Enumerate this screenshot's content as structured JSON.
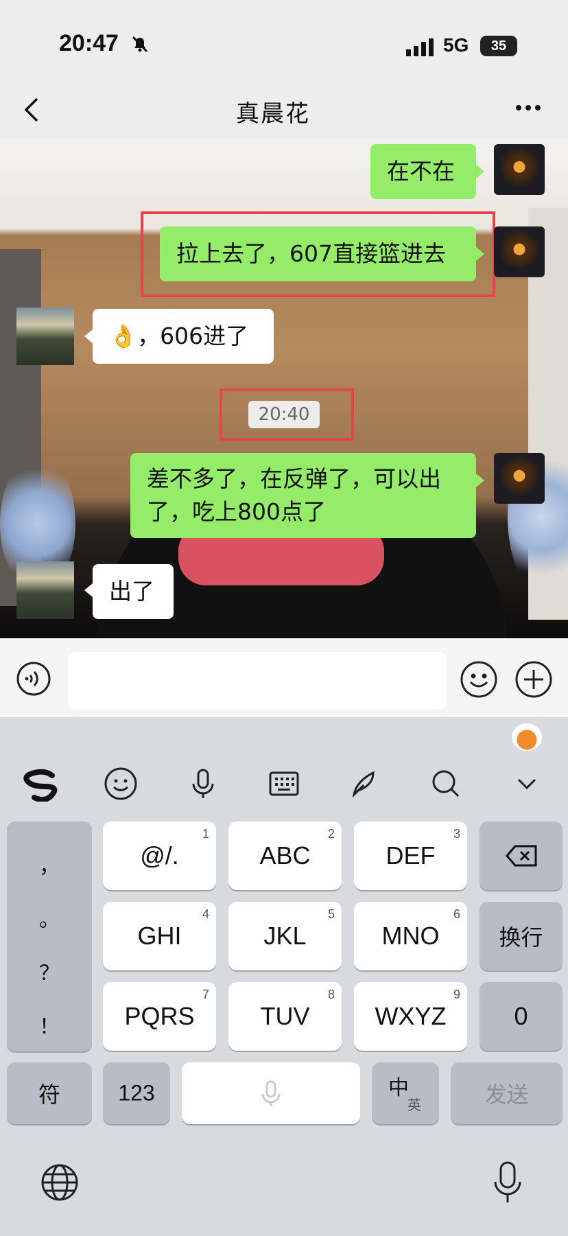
{
  "status_bar": {
    "time": "20:47",
    "network": "5G",
    "battery": "35"
  },
  "nav": {
    "title": "真晨花"
  },
  "messages": [
    {
      "side": "right",
      "text": "在不在"
    },
    {
      "side": "right",
      "text": "拉上去了，607直接篮进去",
      "highlighted": true
    },
    {
      "side": "left",
      "text": "👌，606进了"
    },
    {
      "side": "time",
      "text": "20:40",
      "highlighted": true
    },
    {
      "side": "right",
      "text_line1": "差不多了，在反弹了，可以出",
      "text_line2": "了，吃上800点了"
    },
    {
      "side": "left",
      "text": "出了"
    }
  ],
  "input": {
    "placeholder": ""
  },
  "keyboard": {
    "left_symbols": [
      "，",
      "。",
      "？",
      "！"
    ],
    "keys": [
      {
        "label": "@/.",
        "num": "1"
      },
      {
        "label": "ABC",
        "num": "2"
      },
      {
        "label": "DEF",
        "num": "3"
      },
      {
        "label": "GHI",
        "num": "4"
      },
      {
        "label": "JKL",
        "num": "5"
      },
      {
        "label": "MNO",
        "num": "6"
      },
      {
        "label": "PQRS",
        "num": "7"
      },
      {
        "label": "TUV",
        "num": "8"
      },
      {
        "label": "WXYZ",
        "num": "9"
      }
    ],
    "newline": "换行",
    "zero": "0",
    "symbols": "符",
    "numbers": "123",
    "lang_main": "中",
    "lang_sub": "英",
    "send": "发送"
  },
  "colors": {
    "bubble_green": "#95ec69",
    "highlight_red": "#e5454a",
    "keyboard_bg": "#d8dae0"
  }
}
